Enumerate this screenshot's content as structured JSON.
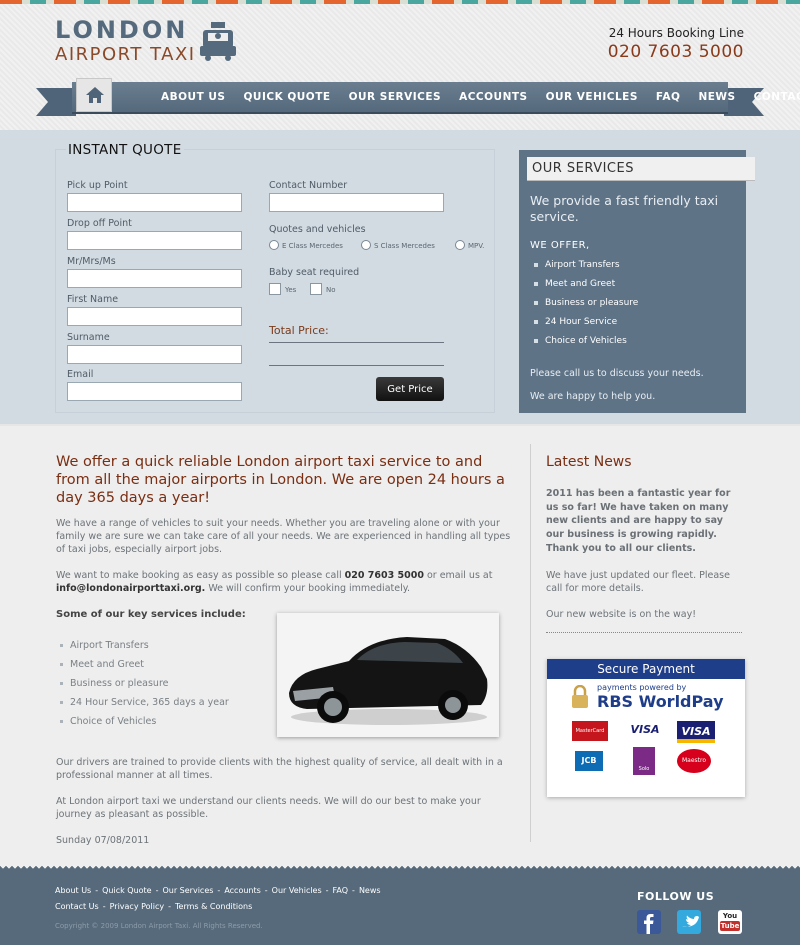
{
  "logo": {
    "line1": "LONDON",
    "line2": "AIRPORT TAXI"
  },
  "booking": {
    "label": "24 Hours Booking Line",
    "phone": "020 7603 5000"
  },
  "nav": [
    "ABOUT US",
    "QUICK QUOTE",
    "OUR SERVICES",
    "ACCOUNTS",
    "OUR VEHICLES",
    "FAQ",
    "NEWS",
    "CONTACT US"
  ],
  "quote": {
    "title": "INSTANT QUOTE",
    "labels": {
      "pickup": "Pick up Point",
      "dropoff": "Drop off Point",
      "title": "Mr/Mrs/Ms",
      "firstname": "First Name",
      "surname": "Surname",
      "email": "Email",
      "contact": "Contact Number",
      "vehicles": "Quotes and vehicles",
      "baby": "Baby seat required"
    },
    "vehicle_options": [
      "E Class Mercedes",
      "S Class Mercedes",
      "MPV."
    ],
    "baby_options": [
      "Yes",
      "No"
    ],
    "total_label": "Total Price:",
    "button": "Get Price"
  },
  "services": {
    "title": "OUR SERVICES",
    "lead": "We provide a fast friendly taxi service.",
    "offer": "WE OFFER,",
    "items": [
      "Airport Transfers",
      "Meet and Greet",
      "Business or pleasure",
      "24 Hour Service",
      "Choice of Vehicles"
    ],
    "call": "Please call us to discuss your needs.",
    "happy": "We are happy to help you."
  },
  "main": {
    "heading": "We offer a quick reliable London airport taxi service to and from all the major airports in London. We are open 24 hours a day 365 days a year!",
    "p1": "We have a range of vehicles to suit your needs. Whether you are traveling alone or with your family we are sure we can take care of all your needs. We are experienced in handling all types of taxi jobs, especially airport jobs.",
    "p2_a": "We want to make booking as easy as possible so please call ",
    "p2_phone": "020 7603 5000",
    "p2_b": " or email us at ",
    "p2_email": "info@londonairporttaxi.org.",
    "p2_c": " We will confirm your booking immediately.",
    "key_heading": "Some of our key services include:",
    "key_items": [
      "Airport Transfers",
      "Meet and Greet",
      "Business or pleasure",
      "24 Hour Service, 365 days a year",
      "Choice of Vehicles"
    ],
    "p3": "Our drivers are trained to provide clients with the highest quality of service, all dealt with in a professional manner at all times.",
    "p4": "At London airport taxi we understand our clients needs. We will do our best to make your journey as pleasant as possible.",
    "date": "Sunday 07/08/2011"
  },
  "news": {
    "title": "Latest News",
    "lead": "2011 has been a fantastic year for us so far! We have taken on many new clients and are happy to say our business is growing rapidly. Thank you to all our clients.",
    "p1": "We have just updated our fleet. Please call for more details.",
    "p2": "Our new website is on the way!"
  },
  "payment": {
    "title": "Secure Payment",
    "powered": "payments powered by",
    "provider": "RBS WorldPay",
    "cards": [
      "MasterCard",
      "VISA",
      "VISA",
      "JCB",
      "Solo",
      "Maestro"
    ]
  },
  "footer": {
    "links1": [
      "About Us",
      "Quick Quote",
      "Our Services",
      "Accounts",
      "Our Vehicles",
      "FAQ",
      "News"
    ],
    "links2": [
      "Contact Us",
      "Privacy Policy",
      "Terms & Conditions"
    ],
    "copyright": "Copyright © 2009 London Airport Taxi. All Rights Reserved.",
    "follow": "FOLLOW US",
    "youtube": "You Tube"
  },
  "colors": {
    "accent": "#7a2e12",
    "nav": "#5f7387",
    "footer": "#566a7c"
  }
}
